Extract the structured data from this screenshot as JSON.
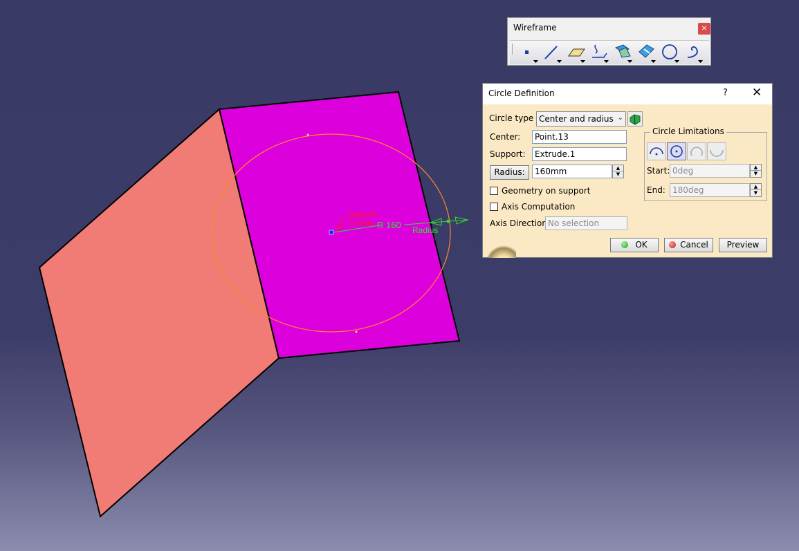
{
  "colors": {
    "face_left": "#f17b75",
    "face_right": "#dc00dc",
    "circle": "#ff8a2a",
    "label_red": "#ff1a1a",
    "label_green": "#2fe02f",
    "point": "#2020ff"
  },
  "viewport": {
    "support_label": "Support",
    "center_label": "Center",
    "radius_value_label": "R 160",
    "radius_label": "Radius"
  },
  "wireframe_toolbar": {
    "title": "Wireframe",
    "close": "×",
    "tools": [
      {
        "icon": "point-icon"
      },
      {
        "icon": "line-icon"
      },
      {
        "icon": "plane-icon"
      },
      {
        "icon": "projection-icon"
      },
      {
        "icon": "intersection-icon"
      },
      {
        "icon": "offset-icon"
      },
      {
        "icon": "circle-icon"
      },
      {
        "icon": "spline-icon"
      }
    ]
  },
  "dialog": {
    "title": "Circle Definition",
    "help": "?",
    "close": "✕",
    "circle_type_label": "Circle type :",
    "circle_type_value": "Center and radius",
    "center_label": "Center:",
    "center_value": "Point.13",
    "support_label": "Support:",
    "support_value": "Extrude.1",
    "radius_button": "Radius:",
    "radius_value": "160mm",
    "geometry_on_support": "Geometry on support",
    "axis_computation": "Axis Computation",
    "axis_direction_label": "Axis Direction:",
    "axis_direction_value": "No selection",
    "limitations": {
      "title": "Circle Limitations",
      "start_label": "Start:",
      "start_value": "0deg",
      "end_label": "End:",
      "end_value": "180deg"
    },
    "ok": "OK",
    "cancel": "Cancel",
    "preview": "Preview"
  }
}
